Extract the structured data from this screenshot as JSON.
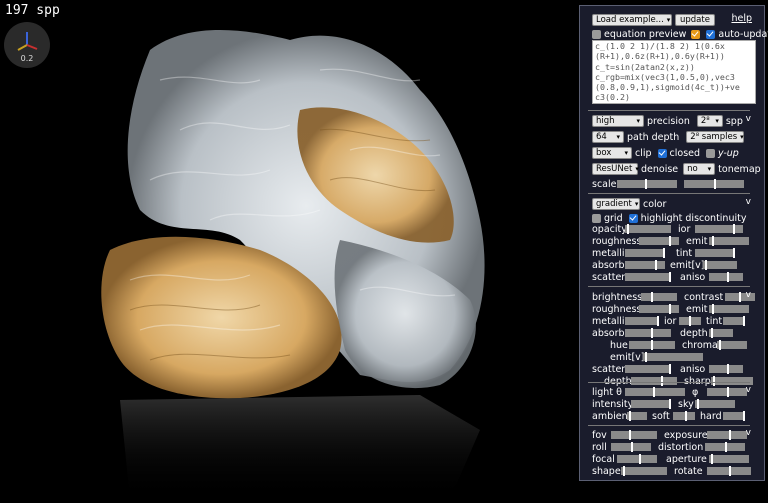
{
  "spp_counter": "197 spp",
  "gizmo_value": "0.2",
  "panel": {
    "load_example": "Load example...",
    "update": "update",
    "help": "help",
    "equation_preview": "equation preview",
    "auto_update": "auto-update",
    "code_lines": [
      "c_(1.0 2 1)/(1.8 2) 1(0.6x",
      "(R+1),0.6z(R+1),0.6y(R+1))",
      "c_t=sin(2atan2(x,z))",
      "c_rgb=mix(vec3(1,0.5,0),vec3",
      "(0.8,0.9,1),sigmoid(4c_t))+ve",
      "c3(0.2)"
    ],
    "precision_select": "high",
    "precision_label": "precision",
    "spp_select": "2⁸",
    "spp_label": "spp",
    "path_depth_select": "64",
    "path_depth_label": "path depth",
    "samples_select": "2⁸ samples",
    "clip_select": "box",
    "clip_label": "clip",
    "closed_label": "closed",
    "yup_label": "y-up",
    "denoise_select": "ResUNet",
    "denoise_label": "denoise",
    "tonemap_select": "no",
    "tonemap_label": "tonemap",
    "scale_label": "scale",
    "color_select": "gradient",
    "color_label": "color",
    "grid_label": "grid",
    "highlight_label": "highlight discontinuity",
    "mat1": {
      "opacity": "opacity",
      "ior": "ior",
      "roughness": "roughness",
      "emit": "emit",
      "metallic": "metallic",
      "tint": "tint",
      "absorb": "absorb",
      "emitv": "emit[v]",
      "scatter": "scatter",
      "aniso": "aniso"
    },
    "mat2": {
      "brightness": "brightness",
      "contrast": "contrast",
      "roughness": "roughness",
      "emit": "emit",
      "metallic": "metallic",
      "ior": "ior",
      "tint": "tint",
      "absorb": "absorb",
      "depth": "depth",
      "hue": "hue",
      "chroma": "chroma",
      "emitv": "emit[v]",
      "scatter": "scatter",
      "aniso": "aniso",
      "depth2": "depth",
      "sharp": "sharp"
    },
    "light": {
      "light_theta": "light θ",
      "phi": "φ",
      "intensity": "intensity",
      "sky": "sky",
      "ambient": "ambient",
      "soft": "soft",
      "hard": "hard"
    },
    "camera": {
      "fov": "fov",
      "exposure": "exposure",
      "roll": "roll",
      "distortion": "distortion",
      "focal": "focal",
      "aperture": "aperture",
      "shape": "shape",
      "rotate": "rotate"
    },
    "collapse_glyph": "v"
  }
}
